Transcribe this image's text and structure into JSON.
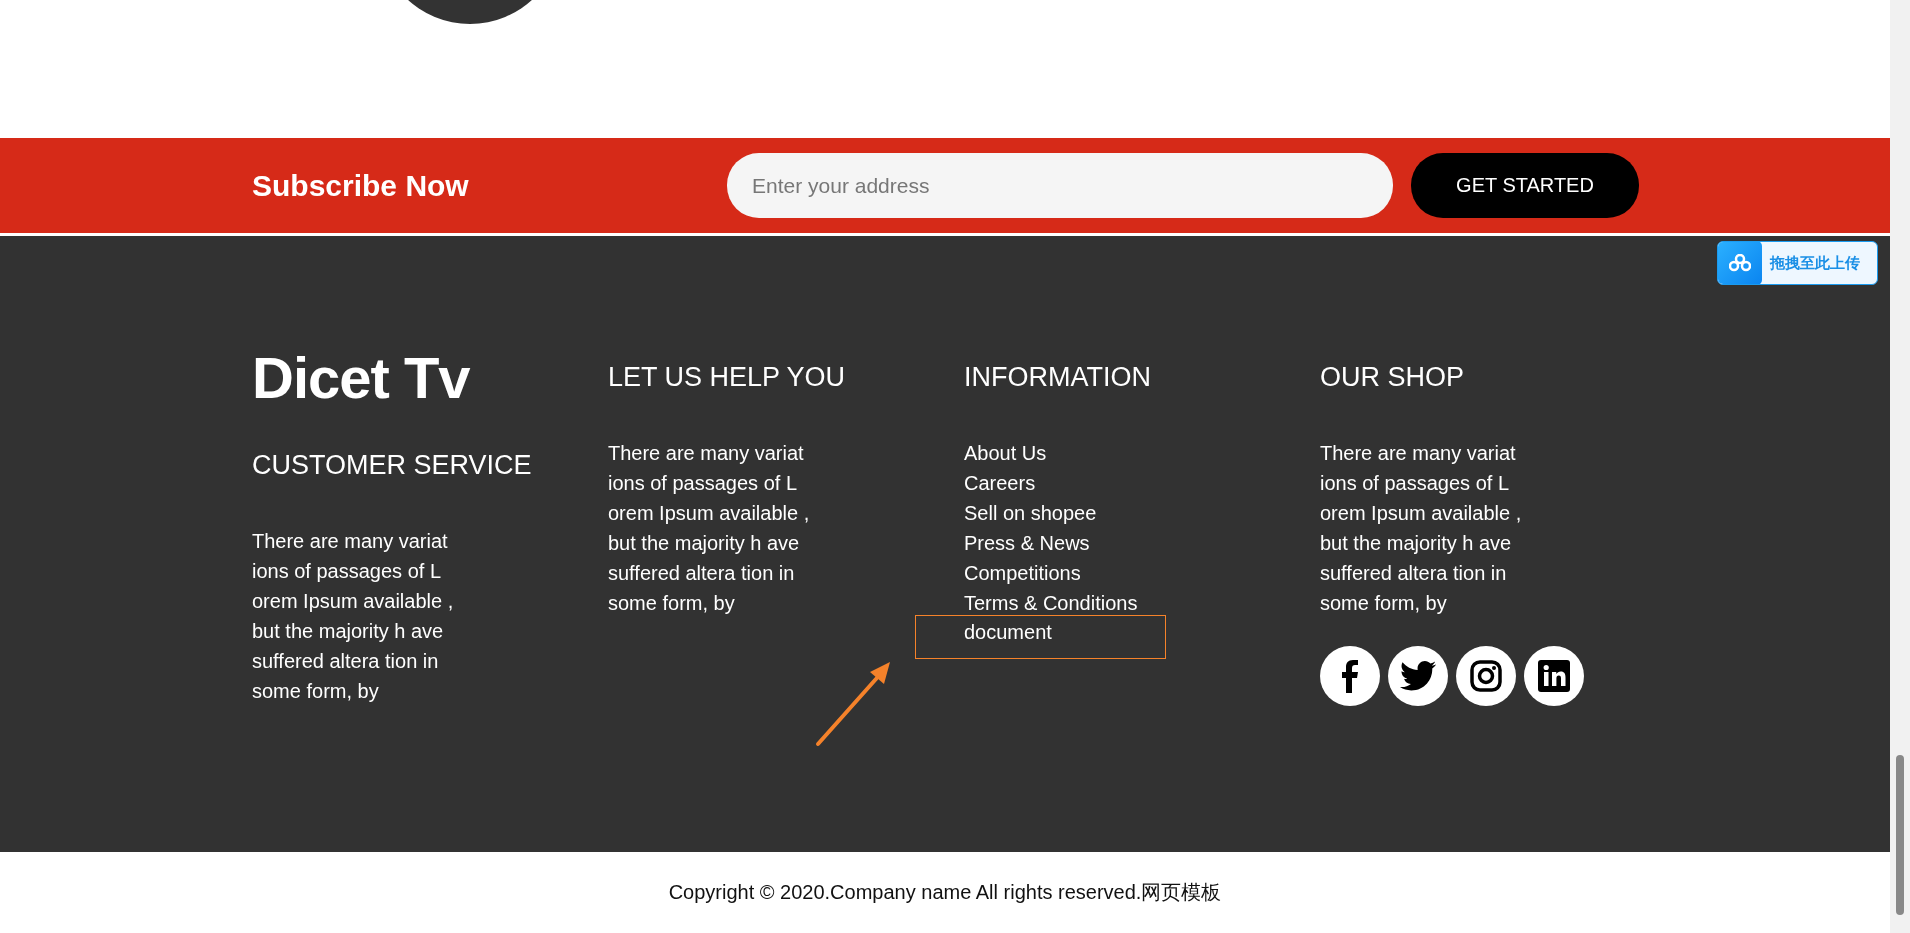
{
  "subscribe": {
    "title": "Subscribe Now",
    "email_field": {
      "placeholder": "Enter your address"
    },
    "button": "GET STARTED"
  },
  "footer": {
    "logo": "Dicet Tv",
    "columns": [
      {
        "kind": "text",
        "heading": "CUSTOMER SERVICE",
        "lines": [
          "There are many variat",
          "ions of passages of L",
          "orem Ipsum available ,",
          "but the majority h ave",
          "suffered altera tion in",
          "some form, by"
        ]
      },
      {
        "kind": "text",
        "heading": "LET US HELP YOU",
        "lines": [
          "There are many variat",
          "ions of passages of L",
          "orem Ipsum available ,",
          "but the majority h ave",
          "suffered altera tion in",
          "some form, by"
        ]
      },
      {
        "kind": "links",
        "heading": "INFORMATION",
        "links": [
          {
            "label": "About Us",
            "highlighted": false
          },
          {
            "label": "Careers",
            "highlighted": false
          },
          {
            "label": "Sell on shopee",
            "highlighted": false
          },
          {
            "label": "Press & News",
            "highlighted": false
          },
          {
            "label": "Competitions",
            "highlighted": false
          },
          {
            "label": "Terms & Conditions",
            "highlighted": false
          },
          {
            "label": "document",
            "highlighted": true
          }
        ]
      },
      {
        "kind": "social",
        "heading": "OUR SHOP",
        "lines": [
          "There are many variat",
          "ions of passages of L",
          "orem Ipsum available ,",
          "but the majority h ave",
          "suffered altera tion in",
          "some form, by"
        ],
        "social": [
          {
            "kind": "facebook"
          },
          {
            "kind": "twitter"
          },
          {
            "kind": "instagram"
          },
          {
            "kind": "linkedin"
          }
        ]
      }
    ]
  },
  "upload_widget": {
    "label": "拖拽至此上传"
  },
  "copyright": "Copyright © 2020.Company name All rights reserved.网页模板"
}
